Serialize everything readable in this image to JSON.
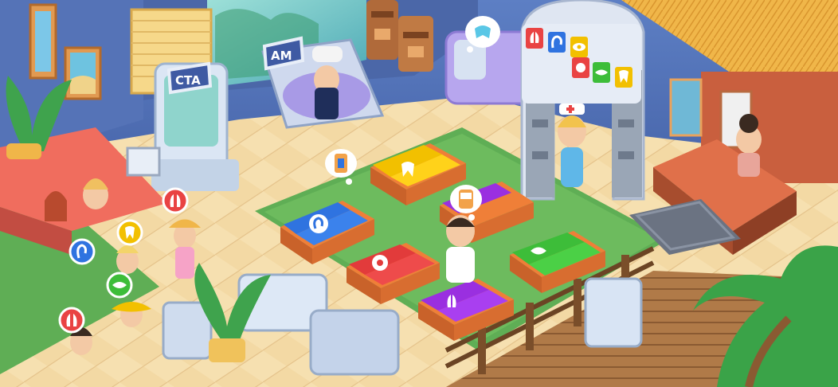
{
  "signs": {
    "cta": "CTA",
    "am": "AM"
  },
  "palette": {
    "floor_light": "#f3d9a4",
    "floor_dark": "#e7c184",
    "carpet_green": "#5fae55",
    "bed_blue": "#2f73e0",
    "bed_yellow": "#f2c000",
    "bed_red": "#e23b3b",
    "bed_green": "#3dbd39",
    "bed_purple": "#9a2fe0",
    "bed_frame": "#ef7f38",
    "wall_blue": "#4b67a8",
    "roof_straw": "#f0b649",
    "hut_wall": "#c95f3e",
    "sign_frame": "#e8eef8"
  },
  "station_icons": [
    "lungs-icon",
    "ear-icon",
    "eye-icon",
    "virus-icon",
    "lips-icon",
    "tooth-icon"
  ],
  "patient_queue_icons": [
    "lungs-icon",
    "tooth-icon",
    "ear-icon",
    "lips-icon",
    "lungs-icon"
  ],
  "beds": [
    {
      "name": "bed-ear",
      "icon": "ear-icon",
      "color": "blue"
    },
    {
      "name": "bed-tooth",
      "icon": "tooth-icon",
      "color": "yellow"
    },
    {
      "name": "bed-virus",
      "icon": "virus-icon",
      "color": "red"
    },
    {
      "name": "bed-lips",
      "icon": "lips-icon",
      "color": "green"
    },
    {
      "name": "bed-lungs-left",
      "icon": "lungs-icon",
      "color": "purple"
    },
    {
      "name": "bed-lungs-right",
      "icon": "lungs-icon",
      "color": "purple"
    }
  ]
}
